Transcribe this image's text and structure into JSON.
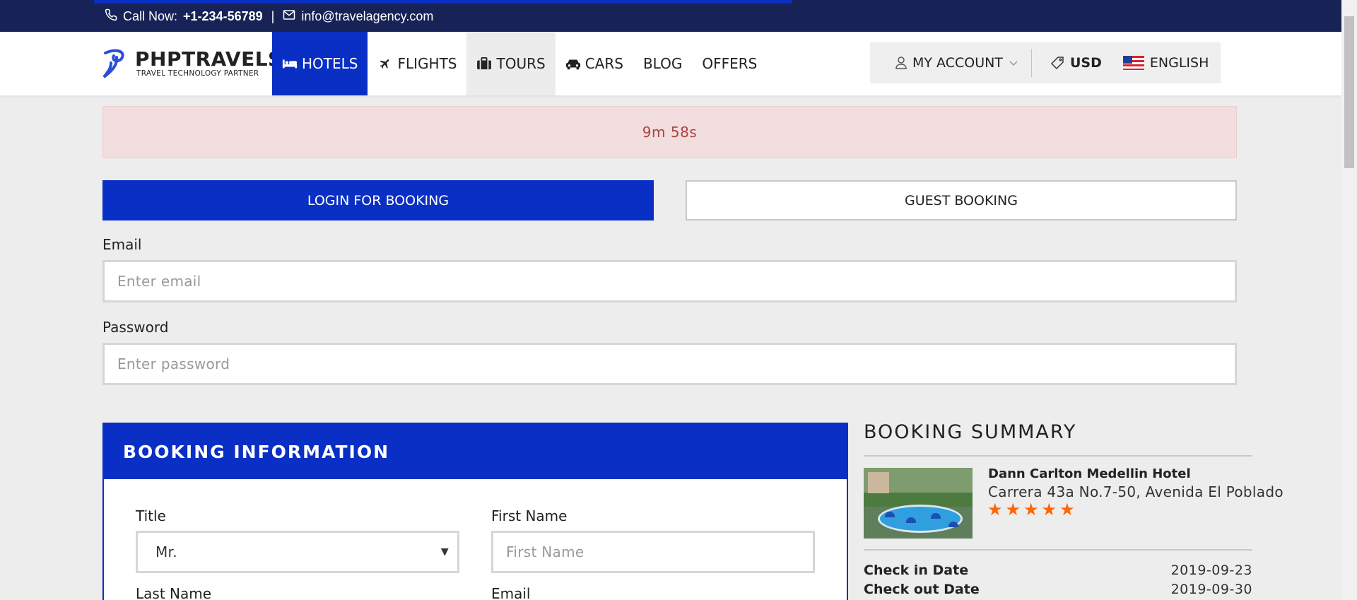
{
  "topbar": {
    "call_label": "Call Now:",
    "phone": "+1-234-56789",
    "divider": "|",
    "email": "info@travelagency.com"
  },
  "header": {
    "logo_title": "PHPTRAVELS",
    "logo_subtitle": "TRAVEL TECHNOLOGY PARTNER",
    "nav": [
      {
        "label": "HOTELS",
        "icon": "bed-icon",
        "active": true
      },
      {
        "label": "FLIGHTS",
        "icon": "plane-icon"
      },
      {
        "label": "TOURS",
        "icon": "suitcase-icon"
      },
      {
        "label": "CARS",
        "icon": "car-icon"
      },
      {
        "label": "BLOG"
      },
      {
        "label": "OFFERS"
      }
    ],
    "account": {
      "my_account": "MY ACCOUNT",
      "currency": "USD",
      "language": "ENGLISH"
    }
  },
  "timer": {
    "text": "9m 58s"
  },
  "booking_tabs": {
    "login": "LOGIN FOR BOOKING",
    "guest": "GUEST BOOKING"
  },
  "login_form": {
    "email_label": "Email",
    "email_placeholder": "Enter email",
    "password_label": "Password",
    "password_placeholder": "Enter password"
  },
  "booking_info": {
    "title": "BOOKING INFORMATION",
    "title_label": "Title",
    "title_value": "Mr.",
    "first_name_label": "First Name",
    "first_name_placeholder": "First Name",
    "last_name_label": "Last Name",
    "email_label": "Email"
  },
  "summary": {
    "title": "BOOKING SUMMARY",
    "hotel_name": "Dann Carlton Medellin Hotel",
    "hotel_address": "Carrera 43a No.7-50, Avenida El Poblado",
    "stars": 5,
    "checkin_label": "Check in Date",
    "checkin_value": "2019-09-23",
    "checkout_label": "Check out Date",
    "checkout_value": "2019-09-30"
  },
  "colors": {
    "primary": "#0a2fc4",
    "topbar": "#172257",
    "alert_bg": "#f2dede",
    "alert_text": "#a94442",
    "star": "#ff6600"
  }
}
